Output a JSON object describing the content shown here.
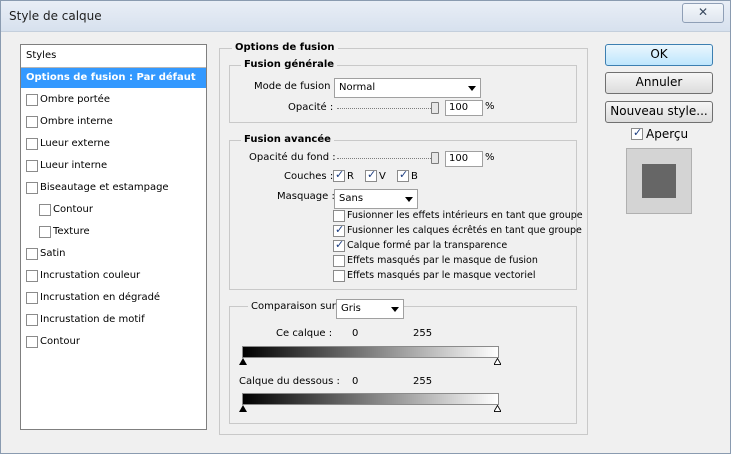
{
  "window": {
    "title": "Style de calque"
  },
  "styles": {
    "header": "Styles",
    "selected": "Options de fusion : Par défaut",
    "items": [
      {
        "label": "Ombre portée",
        "checked": false,
        "indent": false
      },
      {
        "label": "Ombre interne",
        "checked": false,
        "indent": false
      },
      {
        "label": "Lueur externe",
        "checked": false,
        "indent": false
      },
      {
        "label": "Lueur interne",
        "checked": false,
        "indent": false
      },
      {
        "label": "Biseautage et estampage",
        "checked": false,
        "indent": false
      },
      {
        "label": "Contour",
        "checked": false,
        "indent": true
      },
      {
        "label": "Texture",
        "checked": false,
        "indent": true
      },
      {
        "label": "Satin",
        "checked": false,
        "indent": false
      },
      {
        "label": "Incrustation couleur",
        "checked": false,
        "indent": false
      },
      {
        "label": "Incrustation en dégradé",
        "checked": false,
        "indent": false
      },
      {
        "label": "Incrustation de motif",
        "checked": false,
        "indent": false
      },
      {
        "label": "Contour",
        "checked": false,
        "indent": false
      }
    ]
  },
  "fusion": {
    "section_title": "Options de fusion",
    "general": {
      "title": "Fusion générale",
      "mode_label": "Mode de fusion :",
      "mode_value": "Normal",
      "opacity_label": "Opacité :",
      "opacity_value": "100",
      "unit": "%"
    },
    "advanced": {
      "title": "Fusion avancée",
      "fill_label": "Opacité du fond :",
      "fill_value": "100",
      "unit": "%",
      "channels_label": "Couches :",
      "channels": [
        {
          "label": "R",
          "checked": true
        },
        {
          "label": "V",
          "checked": true
        },
        {
          "label": "B",
          "checked": true
        }
      ],
      "knockout_label": "Masquage :",
      "knockout_value": "Sans",
      "options": [
        {
          "label": "Fusionner les effets intérieurs en tant que groupe",
          "checked": false
        },
        {
          "label": "Fusionner les calques écrêtés en tant que groupe",
          "checked": true
        },
        {
          "label": "Calque formé par la transparence",
          "checked": true
        },
        {
          "label": "Effets masqués par le masque de fusion",
          "checked": false
        },
        {
          "label": "Effets masqués par le masque vectoriel",
          "checked": false
        }
      ]
    },
    "blendif": {
      "label": "Comparaison sur :",
      "value": "Gris",
      "this_layer_label": "Ce calque :",
      "this_min": "0",
      "this_max": "255",
      "under_label": "Calque du dessous :",
      "under_min": "0",
      "under_max": "255"
    }
  },
  "buttons": {
    "ok": "OK",
    "cancel": "Annuler",
    "new_style": "Nouveau style...",
    "preview_label": "Aperçu",
    "preview_checked": true
  },
  "icons": {
    "close": "close-icon"
  }
}
